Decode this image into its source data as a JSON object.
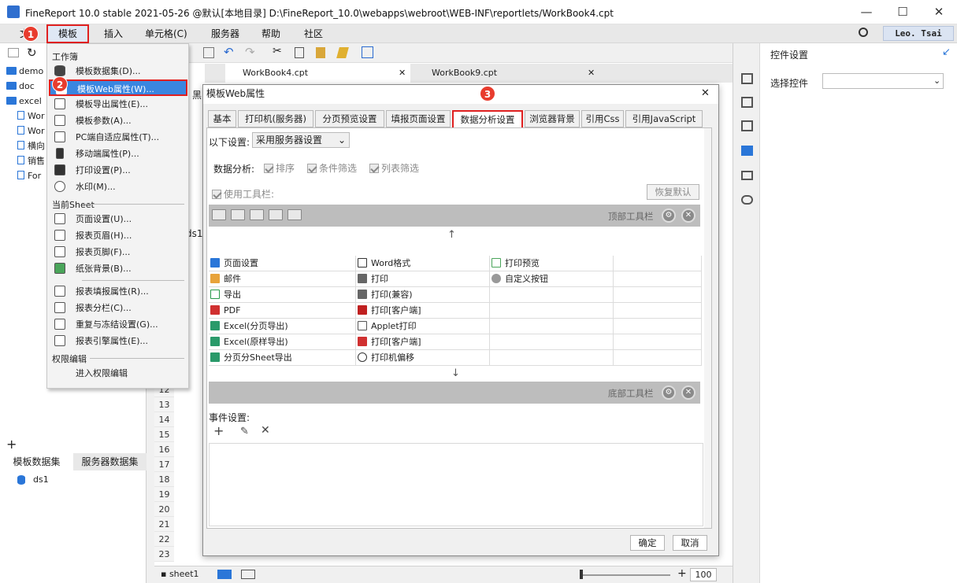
{
  "window": {
    "title": "FineReport 10.0 stable 2021-05-26 @默认[本地目录]    D:\\FineReport_10.0\\webapps\\webroot\\WEB-INF\\reportlets/WorkBook4.cpt",
    "min": "—",
    "max": "☐",
    "close": "✕"
  },
  "menubar": {
    "items": [
      "文",
      "模板",
      "插入",
      "单元格(C)",
      "服务器",
      "帮助",
      "社区"
    ],
    "user": "Leo. Tsai"
  },
  "badges": [
    "1",
    "2",
    "3"
  ],
  "left_tree": {
    "items": [
      "demo",
      "doc",
      "excel",
      "Wor",
      "Wor",
      "横向",
      "销售",
      "For"
    ]
  },
  "left_bottom": {
    "tabs": [
      "模板数据集",
      "服务器数据集"
    ],
    "ds": "ds1"
  },
  "file_tabs": [
    "WorkBook4.cpt",
    "WorkBook9.cpt"
  ],
  "grid": {
    "rows": [
      "12",
      "13",
      "14",
      "15",
      "16",
      "17",
      "18",
      "19",
      "20",
      "21",
      "22",
      "23"
    ],
    "cell_text": "ds1",
    "header_fragment": "黑"
  },
  "sheet": {
    "tab": "sheet1",
    "zoom": "100"
  },
  "right_panel": {
    "title": "控件设置",
    "select_label": "选择控件"
  },
  "menu": {
    "section_workbook": "工作簿",
    "workbook_items": [
      "模板数据集(D)...",
      "模板Web属性(W)...",
      "模板导出属性(E)...",
      "模板参数(A)...",
      "PC端自适应属性(T)...",
      "移动端属性(P)...",
      "打印设置(P)...",
      "水印(M)..."
    ],
    "section_sheet": "当前Sheet",
    "sheet_items": [
      "页面设置(U)...",
      "报表页眉(H)...",
      "报表页脚(F)...",
      "纸张背景(B)..."
    ],
    "sheet_items2": [
      "报表填报属性(R)...",
      "报表分栏(C)...",
      "重复与冻结设置(G)...",
      "报表引擎属性(E)..."
    ],
    "section_perm": "权限编辑",
    "perm_items": [
      "进入权限编辑"
    ]
  },
  "dialog": {
    "title": "模板Web属性",
    "close": "✕",
    "tabs": [
      "基本",
      "打印机(服务器)",
      "分页预览设置",
      "填报页面设置",
      "数据分析设置",
      "浏览器背景",
      "引用Css",
      "引用JavaScript"
    ],
    "setting_label": "以下设置:",
    "setting_value": "采用服务器设置",
    "analysis_label": "数据分析:",
    "analysis_opts": [
      "排序",
      "条件筛选",
      "列表筛选"
    ],
    "use_toolbar": "使用工具栏:",
    "restore": "恢复默认",
    "top_toolbar": "顶部工具栏",
    "bottom_toolbar": "底部工具栏",
    "table": [
      [
        "页面设置",
        "Word格式",
        "打印预览"
      ],
      [
        "邮件",
        "打印",
        "自定义按钮"
      ],
      [
        "导出",
        "打印(兼容)",
        ""
      ],
      [
        "PDF",
        "打印[客户端]",
        ""
      ],
      [
        "Excel(分页导出)",
        "Applet打印",
        ""
      ],
      [
        "Excel(原样导出)",
        "打印[客户端]",
        ""
      ],
      [
        "分页分Sheet导出",
        "打印机偏移",
        ""
      ]
    ],
    "event_label": "事件设置:",
    "ok": "确定",
    "cancel": "取消"
  }
}
